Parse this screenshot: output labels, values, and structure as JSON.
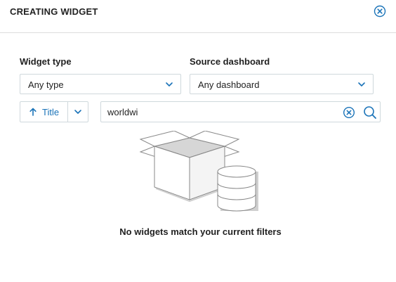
{
  "dialog": {
    "title": "CREATING WIDGET",
    "close_icon": "close-circle-icon"
  },
  "filters": {
    "widget_type": {
      "label": "Widget type",
      "value": "Any type"
    },
    "source_dashboard": {
      "label": "Source dashboard",
      "value": "Any dashboard"
    }
  },
  "sort": {
    "direction_icon": "arrow-up-icon",
    "field": "Title"
  },
  "search": {
    "value": "worldwi",
    "placeholder": ""
  },
  "empty_state": {
    "illustration": "empty-box-database-illustration",
    "message": "No widgets match your current filters"
  },
  "colors": {
    "accent": "#1a73b8",
    "border": "#cfd8dc",
    "text": "#222222"
  }
}
